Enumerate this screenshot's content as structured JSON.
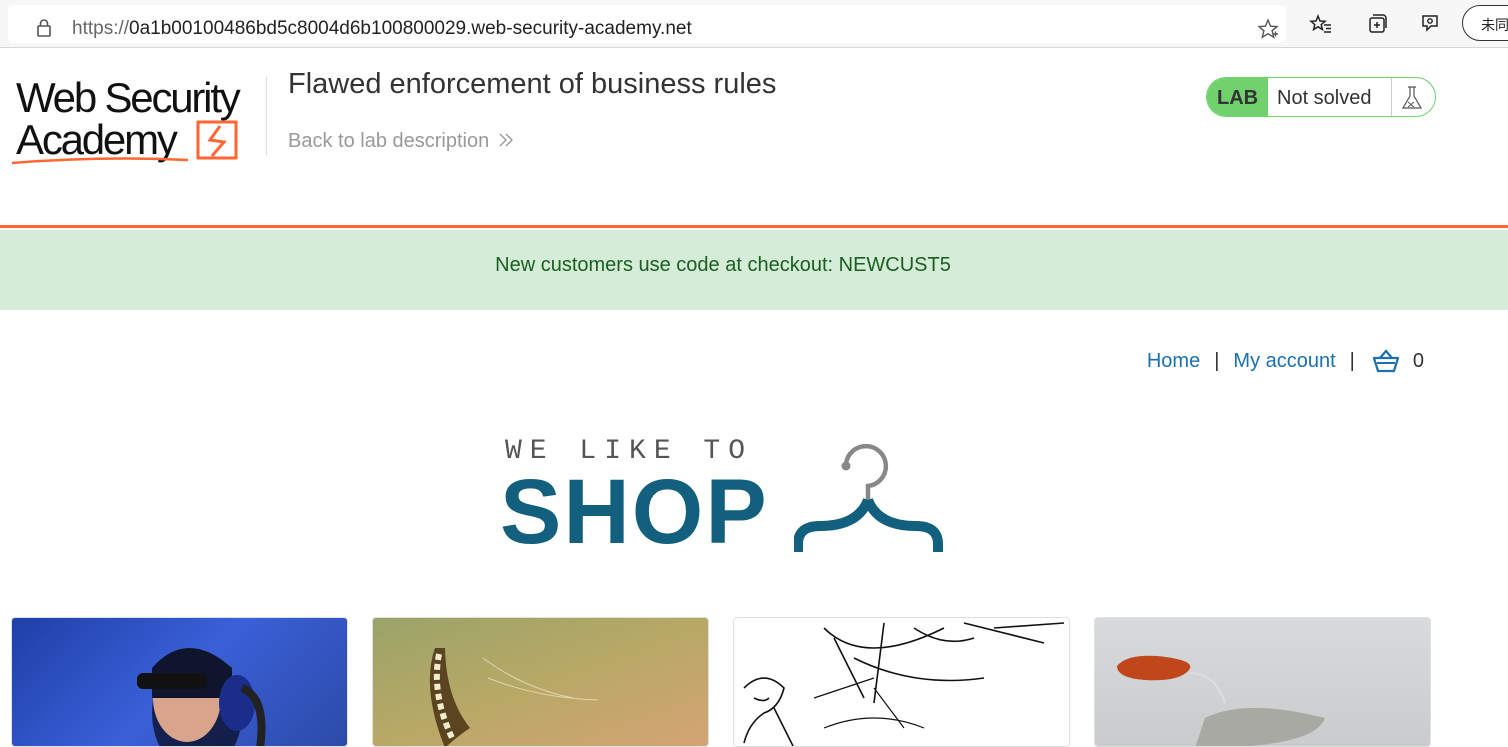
{
  "browser": {
    "url_protocol": "https://",
    "url_host": "0a1b00100486bd5c8004d6b100800029.web-security-academy.net",
    "profile_label": "未同"
  },
  "lab": {
    "logo_line1": "Web Security",
    "logo_line2": "Academy",
    "title": "Flawed enforcement of business rules",
    "back_link": "Back to lab description",
    "badge": "LAB",
    "status": "Not solved"
  },
  "notice": {
    "text": "New customers use code at checkout: NEWCUST5"
  },
  "nav": {
    "home": "Home",
    "separator": "|",
    "my_account": "My account",
    "cart_count": "0"
  },
  "shop_logo": {
    "small": "WE LIKE TO",
    "big": "SHOP"
  },
  "colors": {
    "accent_orange": "#ff6633",
    "lab_green": "#70d16d",
    "notice_bg": "#d4ecd8",
    "link_blue": "#1a70b0",
    "shop_blue": "#12607e"
  },
  "products": [
    {
      "image": "person-with-headphones"
    },
    {
      "image": "mustache-illustration"
    },
    {
      "image": "sketch-drawing"
    },
    {
      "image": "tea-bag"
    }
  ]
}
